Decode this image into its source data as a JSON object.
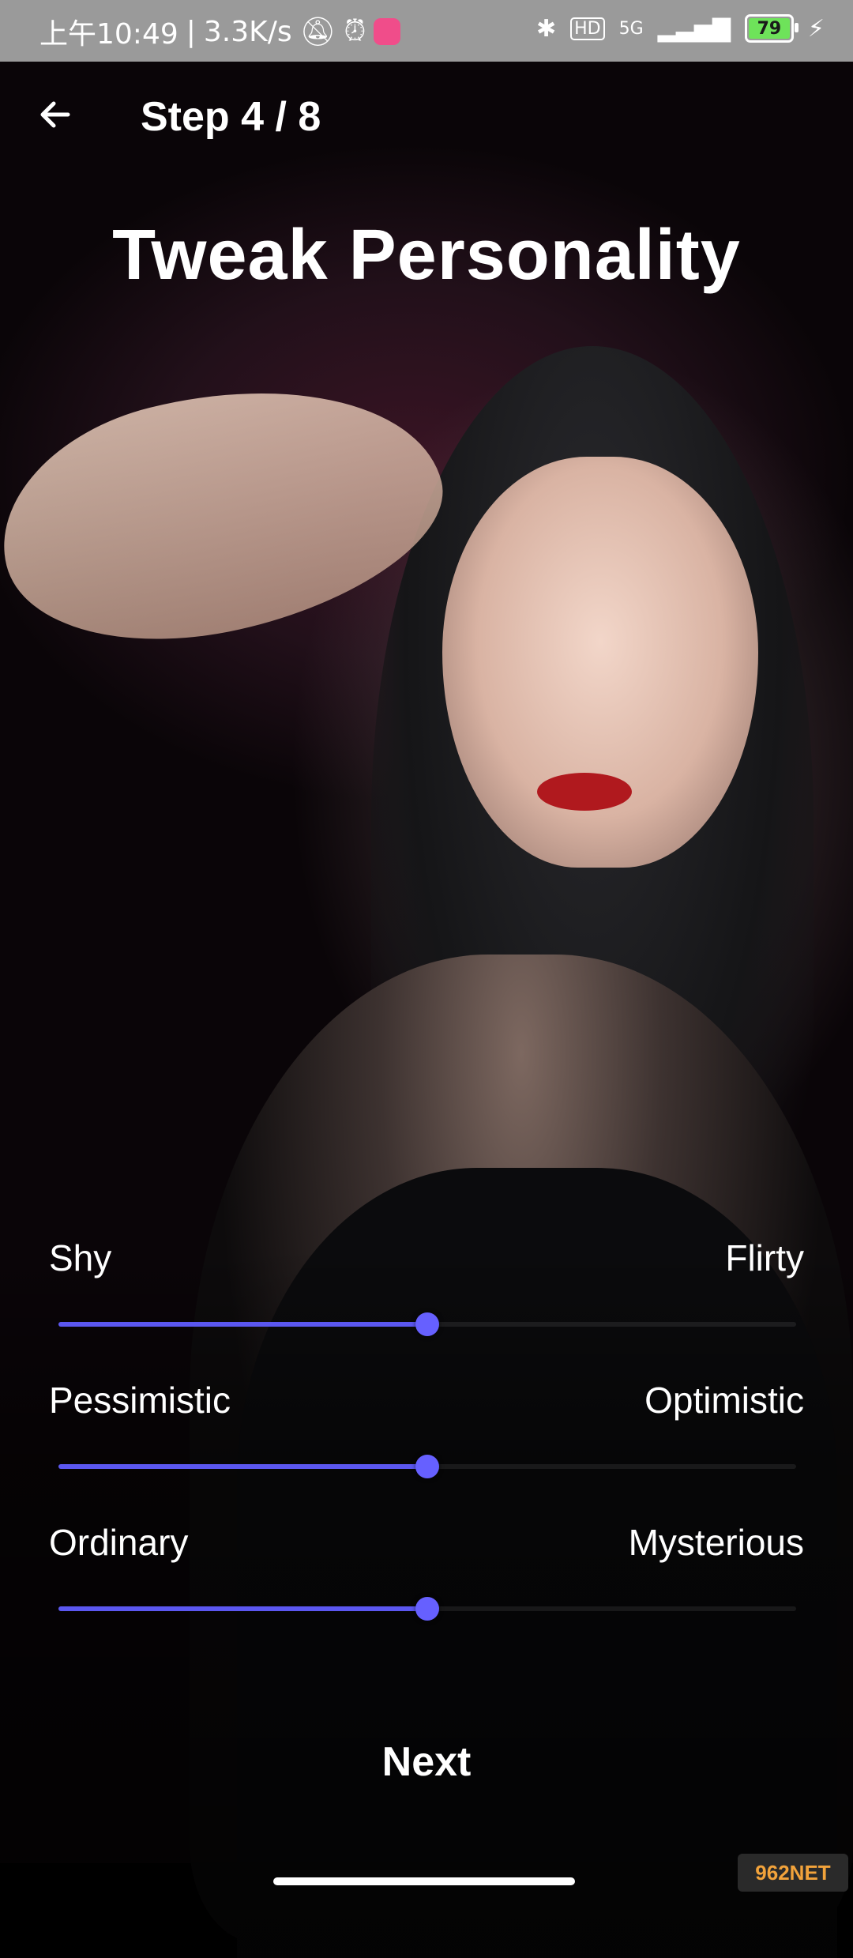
{
  "status_bar": {
    "time": "上午10:49",
    "speed": "3.3K/s",
    "network": "5G",
    "battery": "79",
    "hd": "HD"
  },
  "header": {
    "step": "Step 4 / 8",
    "title": "Tweak Personality"
  },
  "traits": [
    {
      "left": "Shy",
      "right": "Flirty",
      "value": 0.5
    },
    {
      "left": "Pessimistic",
      "right": "Optimistic",
      "value": 0.5
    },
    {
      "left": "Ordinary",
      "right": "Mysterious",
      "value": 0.5
    }
  ],
  "next_label": "Next",
  "watermark": "962NET",
  "colors": {
    "accent": "#5b57f0",
    "thumb": "#6660ff"
  }
}
